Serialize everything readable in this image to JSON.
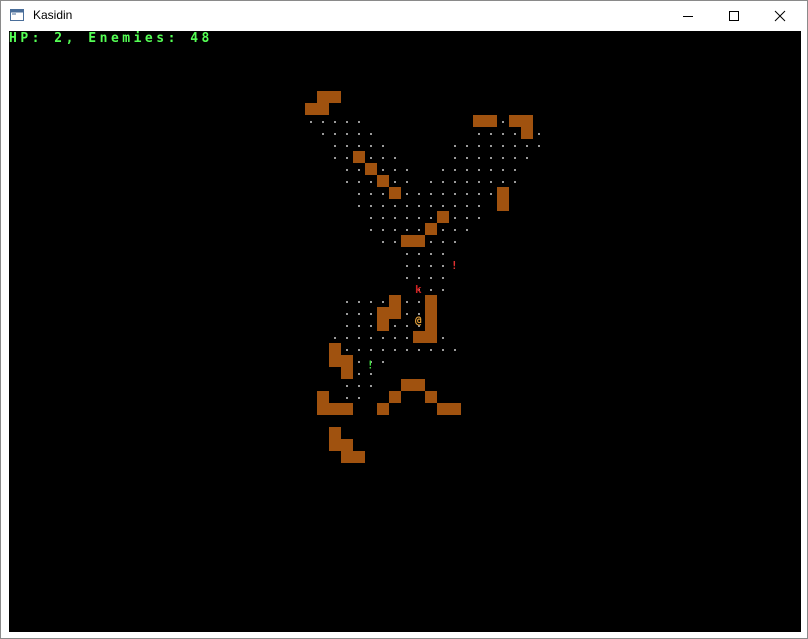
{
  "window": {
    "title": "Kasidin"
  },
  "hud": {
    "hp_label": "HP:",
    "hp": 2,
    "enemies_label": "Enemies:",
    "enemies": 48,
    "text": "HP: 2, Enemies: 48"
  },
  "legend": {
    "floor": ".",
    "wall": "#",
    "player": "@",
    "kobold": "k",
    "potion": "!"
  },
  "colors": {
    "wall": "#a0520f",
    "floor": "#9a9a9a",
    "player": "#e8a33a",
    "enemy": "#cc2222",
    "potion_red": "#e03030",
    "potion_green": "#40e040",
    "hud": "#55ff55"
  },
  "map": [
    "........##........................",
    ".......##.........................",
    "........#............##.##........",
    "........................#.........",
    "........................#.........",
    ".........#........................",
    "..........#.........#.............",
    "...........#......................",
    "............#.........#...........",
    "......................#...........",
    "..............#...................",
    ".............#....................",
    "...........##.....................",
    "..................................",
    "..................................",
    "...........#.#....................",
    "..........##.#....................",
    "..........#.......................",
    "....#......##.....................",
    "....#.............................",
    "....##..............##............",
    ".........##.......................",
    ".........##.......................",
    "...#.##..................##.......",
    "...###.#..........................",
    "..........#..........#............",
    ".......................#..........",
    "....#.............................",
    "....##.##.........................",
    "......##.........................."
  ],
  "entities": [
    {
      "glyph": "k",
      "type": "kobold"
    },
    {
      "glyph": "@",
      "type": "player"
    },
    {
      "glyph": "!",
      "type": "potion_red"
    },
    {
      "glyph": "!",
      "type": "potion_green"
    }
  ]
}
